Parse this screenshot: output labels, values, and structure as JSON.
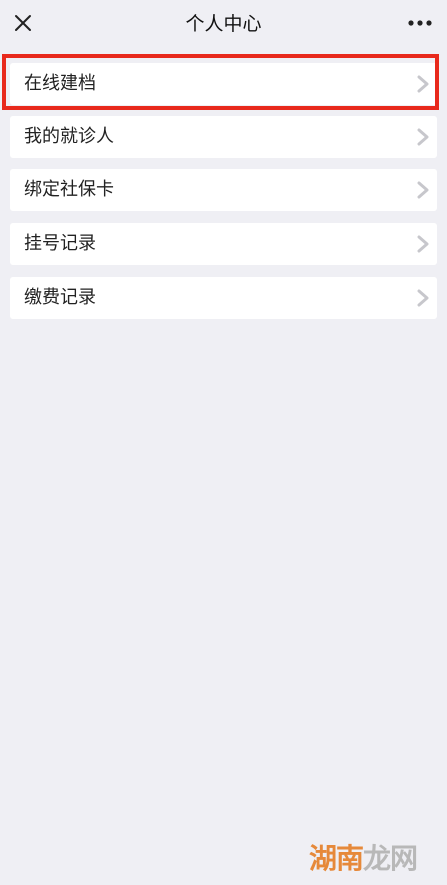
{
  "nav": {
    "title": "个人中心",
    "close_icon": "close-icon",
    "more_icon": "more-icon"
  },
  "menu": {
    "items": [
      {
        "label": "在线建档",
        "highlighted": true
      },
      {
        "label": "我的就诊人",
        "highlighted": false
      },
      {
        "label": "绑定社保卡",
        "highlighted": false
      },
      {
        "label": "挂号记录",
        "highlighted": false
      },
      {
        "label": "缴费记录",
        "highlighted": false
      }
    ]
  },
  "highlight_color": "#e8291c",
  "background_color": "#efeff4",
  "watermark": {
    "left": "湖南",
    "right": "龙网"
  }
}
